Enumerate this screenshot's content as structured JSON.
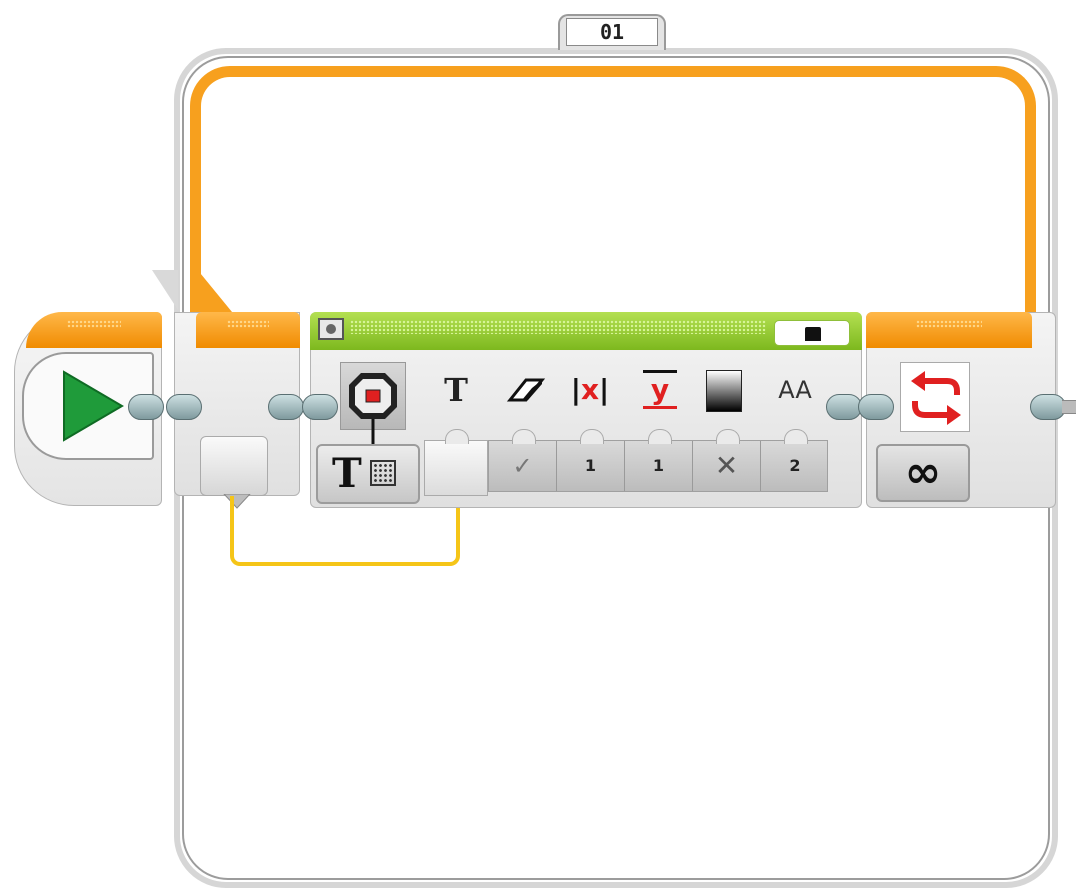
{
  "loop": {
    "label": "01",
    "count_mode_symbol": "∞"
  },
  "display_block": {
    "mode_label_letter": "T",
    "params": {
      "text_icon": "T",
      "clear_icon": "eraser-icon",
      "x_icon": "x",
      "y_icon": "y",
      "color_icon": "color-square-icon",
      "font_icon": "AA"
    },
    "values": {
      "clear": "✓",
      "x": "1",
      "y": "1",
      "color": "✕",
      "font": "2"
    }
  },
  "colors": {
    "loop_orange": "#f7a01e",
    "action_green": "#7db81e",
    "wire_yellow": "#f5c518",
    "start_green": "#1f9b3a",
    "loop_end_red": "#e02020"
  }
}
